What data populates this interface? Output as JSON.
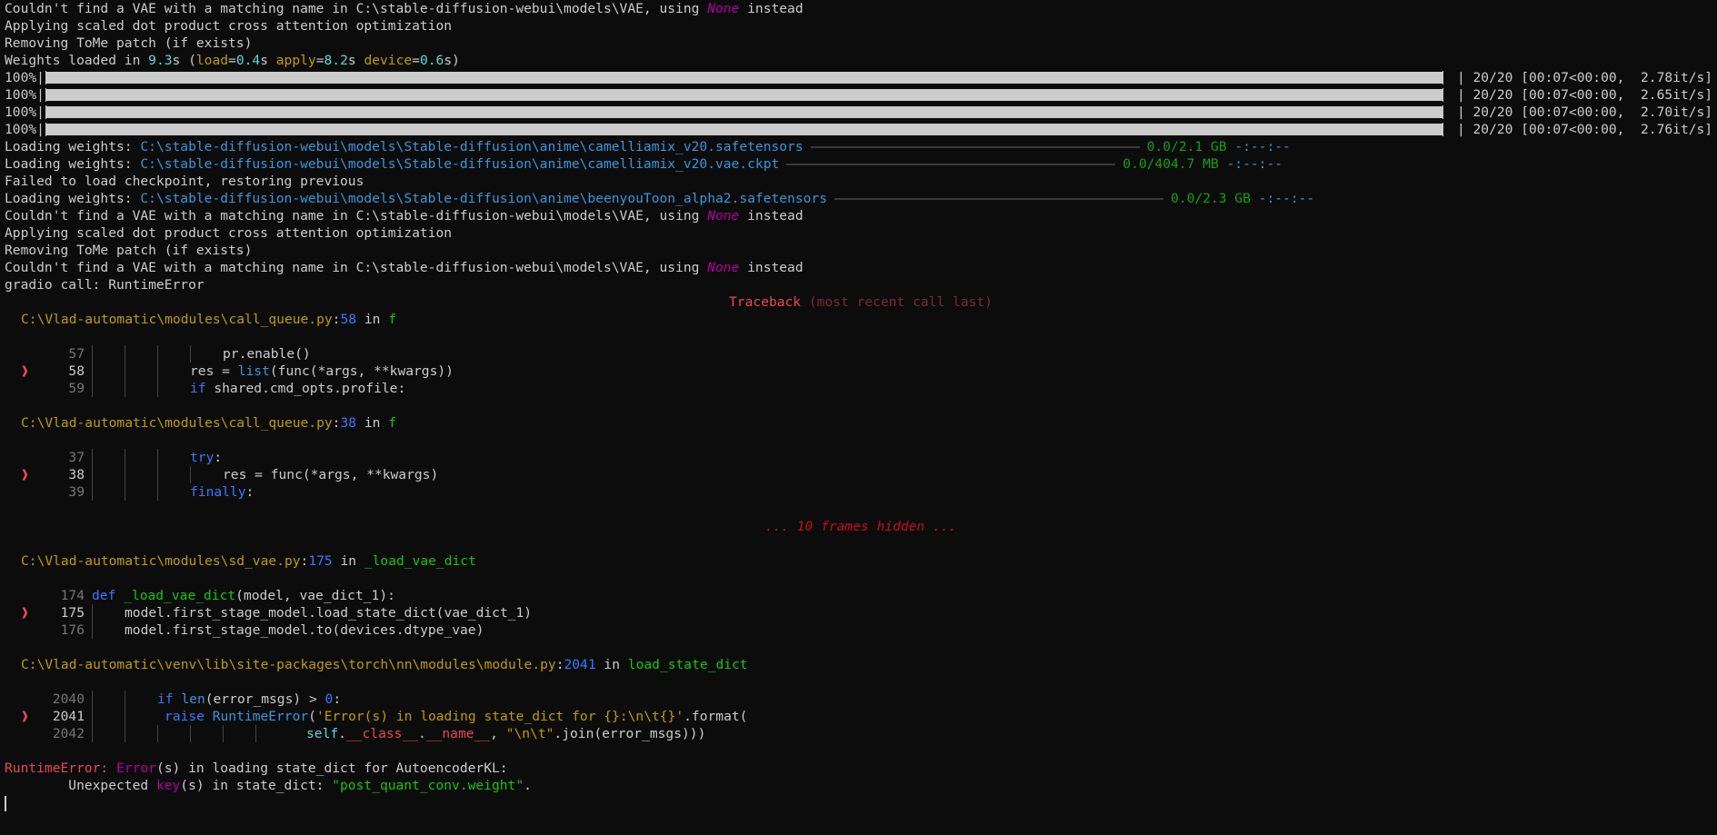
{
  "log": {
    "vae_missing_prefix": "Couldn't find a VAE with a matching name in C:\\stable-diffusion-webui\\models\\VAE, using ",
    "none_word": "None",
    "instead_word": " instead",
    "applying_attn": "Applying scaled dot product cross attention optimization",
    "removing_tome": "Removing ToMe patch (if exists)",
    "weights_loaded_prefix": "Weights loaded in ",
    "weights_total": "9.3",
    "weights_s_open": "s (",
    "load_label": "load",
    "load_value": "0.4",
    "apply_label": "apply",
    "apply_value": "8.2",
    "device_label": "device",
    "device_value": "0.6",
    "s_close": "s)",
    "s_space": "s ",
    "equals": "="
  },
  "progress_bars": [
    {
      "percent_label": "100%|",
      "fill": 1.0,
      "meta": "| 20/20 [00:07<00:00,  2.78it/s]"
    },
    {
      "percent_label": "100%|",
      "fill": 1.0,
      "meta": "| 20/20 [00:07<00:00,  2.65it/s]"
    },
    {
      "percent_label": "100%|",
      "fill": 1.0,
      "meta": "| 20/20 [00:07<00:00,  2.70it/s]"
    },
    {
      "percent_label": "100%|",
      "fill": 1.0,
      "meta": "| 20/20 [00:07<00:00,  2.76it/s]"
    }
  ],
  "loading": {
    "label": "Loading weights: ",
    "items": [
      {
        "path": "C:\\stable-diffusion-webui\\models\\Stable-diffusion\\anime\\camelliamix_v20.safetensors",
        "size": "0.0/2.1 GB",
        "eta": "-:--:--"
      },
      {
        "path": "C:\\stable-diffusion-webui\\models\\Stable-diffusion\\anime\\camelliamix_v20.vae.ckpt",
        "size": "0.0/404.7 MB",
        "eta": "-:--:--"
      },
      {
        "path": "C:\\stable-diffusion-webui\\models\\Stable-diffusion\\anime\\beenyouToon_alpha2.safetensors",
        "size": "0.0/2.3 GB",
        "eta": "-:--:--"
      }
    ],
    "failed_checkpoint": "Failed to load checkpoint, restoring previous"
  },
  "gradio_call": "gradio call: RuntimeError",
  "traceback": {
    "title": "Traceback",
    "subtitle": "(most recent call last)",
    "in_word": " in ",
    "frames_hidden": "... 10 frames hidden ...",
    "frames": [
      {
        "path": "C:\\Vlad-automatic\\modules\\call_queue.py",
        "line": "58",
        "func": "f"
      },
      {
        "path": "C:\\Vlad-automatic\\modules\\call_queue.py",
        "line": "38",
        "func": "f"
      },
      {
        "path": "C:\\Vlad-automatic\\modules\\sd_vae.py",
        "line": "175",
        "func": "_load_vae_dict"
      },
      {
        "path": "C:\\Vlad-automatic\\venv\\lib\\site-packages\\torch\\nn\\modules\\module.py",
        "line": "2041",
        "func": "load_state_dict"
      }
    ],
    "marker": "❱",
    "code": {
      "f1": [
        {
          "ln": "57",
          "text": "pr.enable()"
        },
        {
          "ln": "58",
          "pre": "res = ",
          "builtin": "list",
          "post": "(func(*args, **kwargs))"
        },
        {
          "ln": "59",
          "kw": "if",
          "post": " shared.cmd_opts.profile:"
        }
      ],
      "f2": [
        {
          "ln": "37",
          "kw": "try",
          "post": ":"
        },
        {
          "ln": "38",
          "text": "res = func(*args, **kwargs)"
        },
        {
          "ln": "39",
          "kw": "finally",
          "post": ":"
        }
      ],
      "f3": [
        {
          "ln": "174",
          "kw": "def",
          "fn": "_load_vae_dict",
          "post": "(model, vae_dict_1):"
        },
        {
          "ln": "175",
          "text": "model.first_stage_model.load_state_dict(vae_dict_1)"
        },
        {
          "ln": "176",
          "text": "model.first_stage_model.to(devices.dtype_vae)"
        }
      ],
      "f4": [
        {
          "ln": "2040",
          "kw": "if",
          "space": " ",
          "builtin": "len",
          "mid": "(error_msgs) > ",
          "num": "0",
          "post": ":"
        },
        {
          "ln": "2041",
          "kw": "raise",
          "space": " ",
          "builtin": "RuntimeError",
          "open": "(",
          "str": "'Error(s) in loading state_dict for {}:\\n\\t{}'",
          "post": ".format("
        },
        {
          "ln": "2042",
          "self": "self",
          "dot1": ".",
          "cls": "__class__",
          "dot2": ".",
          "name": "__name__",
          "comma": ", ",
          "str": "\"\\n\\t\"",
          "post": ".join(error_msgs)))"
        }
      ]
    }
  },
  "error": {
    "type": "RuntimeError:",
    "msg_error": "Error",
    "msg_rest": "(s) in loading state_dict for AutoencoderKL:",
    "detail_prefix": "        Unexpected ",
    "detail_key": "key",
    "detail_mid": "(s) in state_dict: ",
    "detail_str": "\"post_quant_conv.weight\"",
    "detail_end": "."
  }
}
